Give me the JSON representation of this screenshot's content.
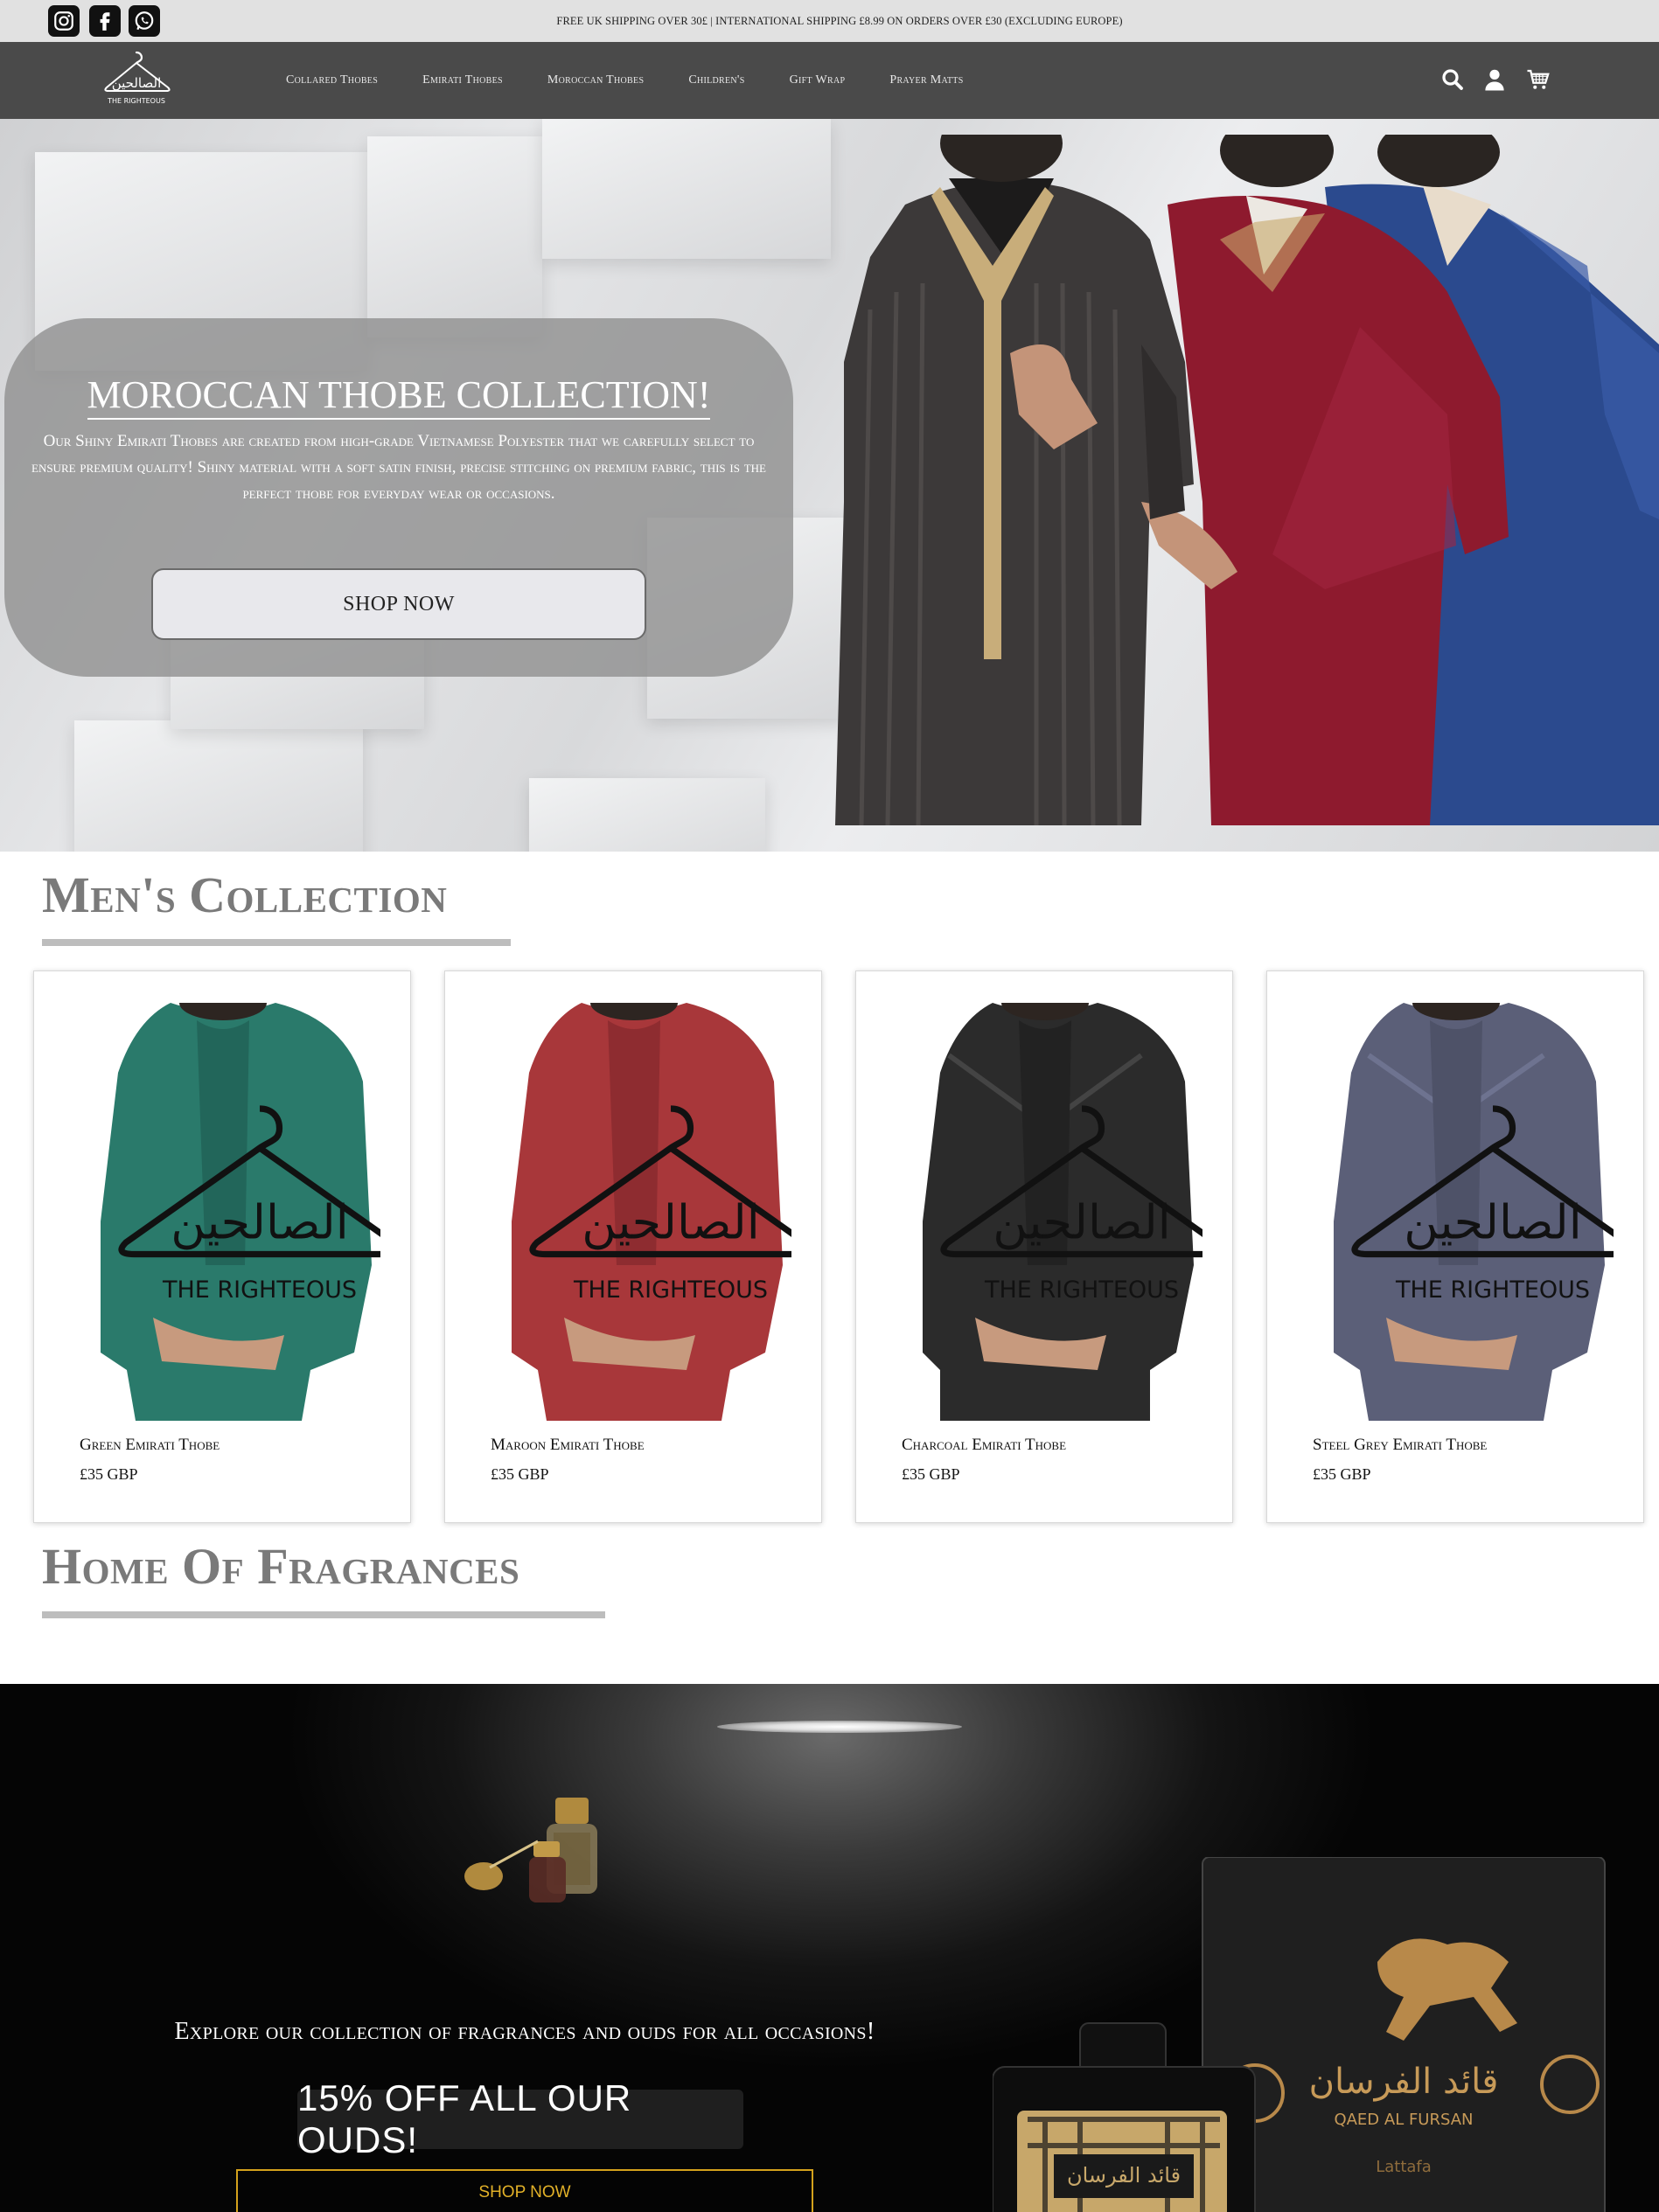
{
  "announcement": "FREE UK SHIPPING OVER 30£ | INTERNATIONAL SHIPPING £8.99 ON ORDERS OVER £30 (EXCLUDING EUROPE)",
  "social": [
    "instagram-icon",
    "facebook-icon",
    "whatsapp-icon"
  ],
  "brand": {
    "arabic": "الصالحين",
    "tagline": "THE RIGHTEOUS"
  },
  "nav": {
    "items": [
      {
        "label": "Collared Thobes"
      },
      {
        "label": "Emirati Thobes"
      },
      {
        "label": "Moroccan Thobes"
      },
      {
        "label": "Children's"
      },
      {
        "label": "Gift Wrap"
      },
      {
        "label": "Prayer Matts"
      }
    ],
    "icons": [
      "search-icon",
      "account-icon",
      "cart-icon"
    ]
  },
  "hero": {
    "title": "MOROCCAN THOBE COLLECTION!",
    "text": "Our Shiny Emirati Thobes are created from high-grade Vietnamese Polyester that we carefully select to ensure premium quality! Shiny material with a soft satin finish, precise stitching on premium fabric, this is the perfect thobe for everyday wear or occasions.",
    "button": "SHOP NOW"
  },
  "mens": {
    "title": "Men's Collection",
    "products": [
      {
        "name": "Green Emirati Thobe",
        "price": "£35 GBP",
        "color": "#2a7a6b"
      },
      {
        "name": "Maroon Emirati Thobe",
        "price": "£35 GBP",
        "color": "#a8373a"
      },
      {
        "name": "Charcoal Emirati Thobe",
        "price": "£35 GBP",
        "color": "#2b2b2b"
      },
      {
        "name": "Steel Grey Emirati Thobe",
        "price": "£35 GBP",
        "color": "#5b5f78"
      }
    ]
  },
  "fragrances": {
    "title": "Home Of Fragrances",
    "text": "Explore our collection of fragrances and ouds for all occasions!",
    "offer": "15% OFF ALL OUR OUDS!",
    "button": "SHOP NOW",
    "box_arabic": "قائد الفرسان",
    "box_name": "QAED AL FURSAN",
    "box_brand": "Lattafa"
  }
}
